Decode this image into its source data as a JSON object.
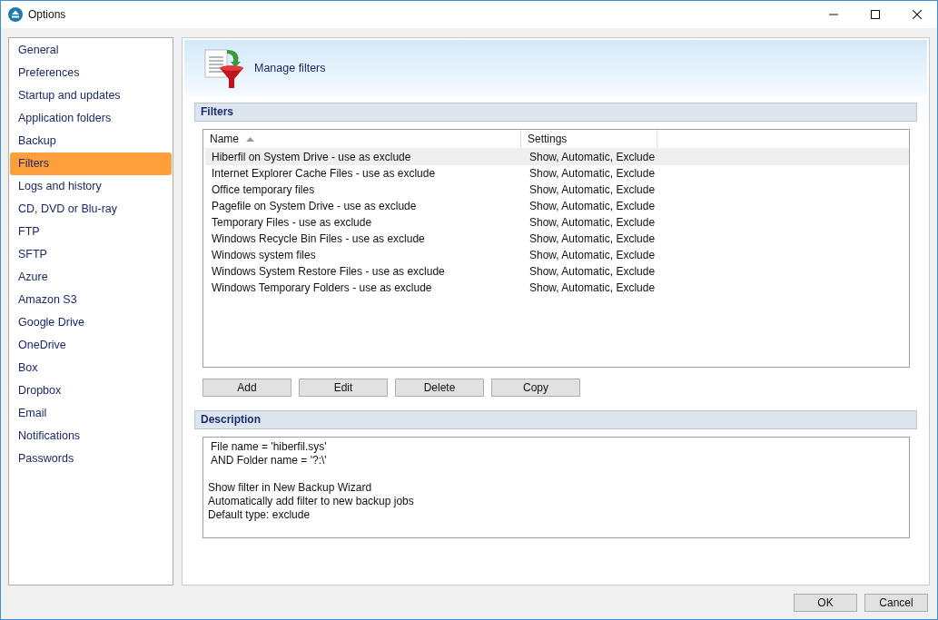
{
  "window": {
    "title": "Options"
  },
  "sidebar": {
    "items": [
      {
        "label": "General",
        "selected": false
      },
      {
        "label": "Preferences",
        "selected": false
      },
      {
        "label": "Startup and updates",
        "selected": false
      },
      {
        "label": "Application folders",
        "selected": false
      },
      {
        "label": "Backup",
        "selected": false
      },
      {
        "label": "Filters",
        "selected": true
      },
      {
        "label": "Logs and history",
        "selected": false
      },
      {
        "label": "CD, DVD or Blu-ray",
        "selected": false
      },
      {
        "label": "FTP",
        "selected": false
      },
      {
        "label": "SFTP",
        "selected": false
      },
      {
        "label": "Azure",
        "selected": false
      },
      {
        "label": "Amazon S3",
        "selected": false
      },
      {
        "label": "Google Drive",
        "selected": false
      },
      {
        "label": "OneDrive",
        "selected": false
      },
      {
        "label": "Box",
        "selected": false
      },
      {
        "label": "Dropbox",
        "selected": false
      },
      {
        "label": "Email",
        "selected": false
      },
      {
        "label": "Notifications",
        "selected": false
      },
      {
        "label": "Passwords",
        "selected": false
      }
    ]
  },
  "page_header": {
    "title": "Manage filters"
  },
  "filters": {
    "title": "Filters",
    "columns": [
      "Name",
      "Settings"
    ],
    "rows": [
      {
        "name": "Hiberfil on System Drive - use as exclude",
        "settings": "Show, Automatic, Exclude",
        "selected": true
      },
      {
        "name": "Internet Explorer Cache Files - use as exclude",
        "settings": "Show, Automatic, Exclude",
        "selected": false
      },
      {
        "name": "Office temporary files",
        "settings": "Show, Automatic, Exclude",
        "selected": false
      },
      {
        "name": "Pagefile on System Drive - use as exclude",
        "settings": "Show, Automatic, Exclude",
        "selected": false
      },
      {
        "name": "Temporary Files - use as exclude",
        "settings": "Show, Automatic, Exclude",
        "selected": false
      },
      {
        "name": "Windows Recycle Bin Files - use as exclude",
        "settings": "Show, Automatic, Exclude",
        "selected": false
      },
      {
        "name": "Windows system files",
        "settings": "Show, Automatic, Exclude",
        "selected": false
      },
      {
        "name": "Windows System Restore Files - use as exclude",
        "settings": "Show, Automatic, Exclude",
        "selected": false
      },
      {
        "name": "Windows Temporary Folders - use as exclude",
        "settings": "Show, Automatic, Exclude",
        "selected": false
      }
    ],
    "buttons": [
      "Add",
      "Edit",
      "Delete",
      "Copy"
    ]
  },
  "description": {
    "title": "Description",
    "lines": [
      {
        "kind": "condition",
        "text": "File name = 'hiberfil.sys'"
      },
      {
        "kind": "condition",
        "text": "AND Folder name = '?:\\'"
      },
      {
        "kind": "blank"
      },
      {
        "kind": "note",
        "text": "Show filter in New Backup Wizard"
      },
      {
        "kind": "note",
        "text": "Automatically add filter to new backup jobs"
      },
      {
        "kind": "note",
        "text": "Default type: exclude"
      }
    ]
  },
  "footer_buttons": [
    "OK",
    "Cancel"
  ]
}
